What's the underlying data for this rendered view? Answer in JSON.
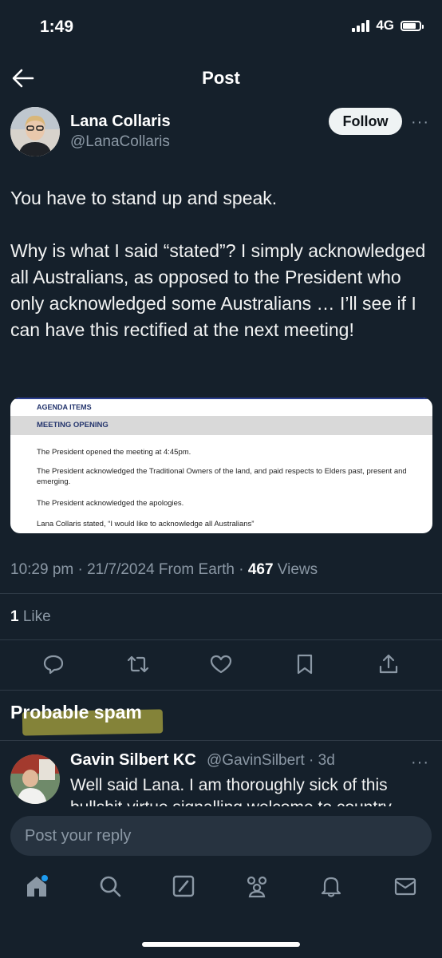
{
  "status_bar": {
    "time": "1:49",
    "network": "4G"
  },
  "header": {
    "title": "Post",
    "back_icon": "arrow-left-icon"
  },
  "post": {
    "author_name": "Lana Collaris",
    "author_handle": "@LanaCollaris",
    "follow_label": "Follow",
    "more_label": "···",
    "text": "You have to stand up and speak.\n\nWhy is what I said “stated”? I simply acknowledged all Australians, as opposed to the President who only acknowledged some Australians … I’ll see if I can have this rectified at the next meeting!",
    "attachment": {
      "heading": "AGENDA ITEMS",
      "section": "MEETING OPENING",
      "lines": [
        "The President opened the meeting at 4:45pm.",
        "The President acknowledged the Traditional Owners of the land, and paid respects to Elders past, present and emerging.",
        "The President acknowledged the apologies.",
        "Lana Collaris stated, “I would like to acknowledge all Australians”"
      ]
    },
    "timestamp": "10:29 pm · 21/7/2024 From Earth · ",
    "views_count": "467",
    "views_label": " Views",
    "likes_count": "1",
    "likes_label": " Like"
  },
  "actions": [
    "reply-icon",
    "retweet-icon",
    "like-icon",
    "bookmark-icon",
    "share-icon"
  ],
  "section_label": "Probable spam",
  "reply": {
    "author_name": "Gavin Silbert KC",
    "meta": "@GavinSilbert · 3d",
    "more_label": "···",
    "text": "Well said Lana. I am thoroughly sick of this bullshit virtue signalling welcome to country"
  },
  "composer": {
    "placeholder": "Post your reply"
  },
  "tabs": [
    "home-icon",
    "search-icon",
    "grok-icon",
    "communities-icon",
    "notifications-icon",
    "messages-icon"
  ],
  "colors": {
    "background": "#15202b",
    "accent": "#1d9bf0",
    "muted": "#8b98a5"
  }
}
